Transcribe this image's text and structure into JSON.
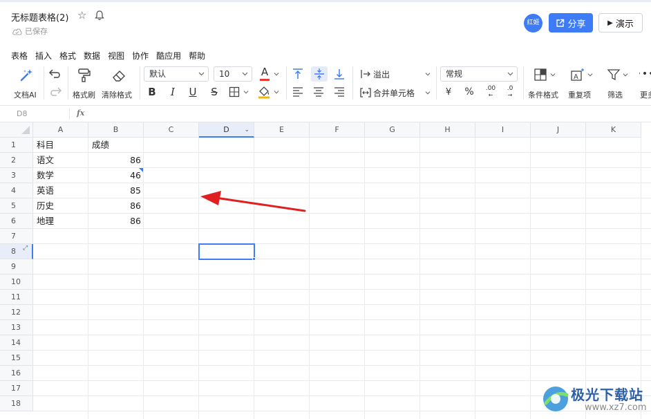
{
  "doc": {
    "title": "无标题表格(2)",
    "saved": "已保存"
  },
  "header": {
    "avatar": "红姬",
    "share": "分享",
    "present": "演示"
  },
  "menu": [
    "表格",
    "插入",
    "格式",
    "数据",
    "视图",
    "协作",
    "酷应用",
    "帮助"
  ],
  "toolbar": {
    "ai": "文档AI",
    "format_painter": "格式刷",
    "clear_format": "清除格式",
    "font": "默认",
    "font_size": "10",
    "font_color_letter": "A",
    "bold": "B",
    "italic": "I",
    "underline": "U",
    "strike": "S",
    "overflow": "溢出",
    "merge": "合并单元格",
    "number_format": "常规",
    "currency": "¥",
    "percent": "%",
    "decimal_inc": ".00",
    "decimal_dec": ".0",
    "conditional": "条件格式",
    "duplicates": "重复项",
    "filter": "筛选",
    "more": "更多"
  },
  "formula_bar": {
    "cell_ref": "D8",
    "fx": "fx"
  },
  "grid": {
    "columns": [
      "A",
      "B",
      "C",
      "D",
      "E",
      "F",
      "G",
      "H",
      "I",
      "J",
      "K"
    ],
    "selected_column": "D",
    "rows": [
      "1",
      "2",
      "3",
      "4",
      "5",
      "6",
      "7",
      "8",
      "9",
      "10",
      "11",
      "12",
      "13",
      "14",
      "15",
      "16",
      "17",
      "18"
    ],
    "selected_row": "8",
    "cells": {
      "A1": "科目",
      "B1": "成绩",
      "A2": "语文",
      "B2": "86",
      "A3": "数学",
      "B3": "46",
      "A4": "英语",
      "B4": "85",
      "A5": "历史",
      "B5": "86",
      "A6": "地理",
      "B6": "86"
    }
  },
  "watermark": {
    "name": "极光下载站",
    "url": "www.xz7.com"
  },
  "colors": {
    "accent": "#3e7bf7",
    "annotation_arrow": "#e02020",
    "font_color_bar": "#e53935",
    "fill_color_bar": "#f2b705"
  }
}
